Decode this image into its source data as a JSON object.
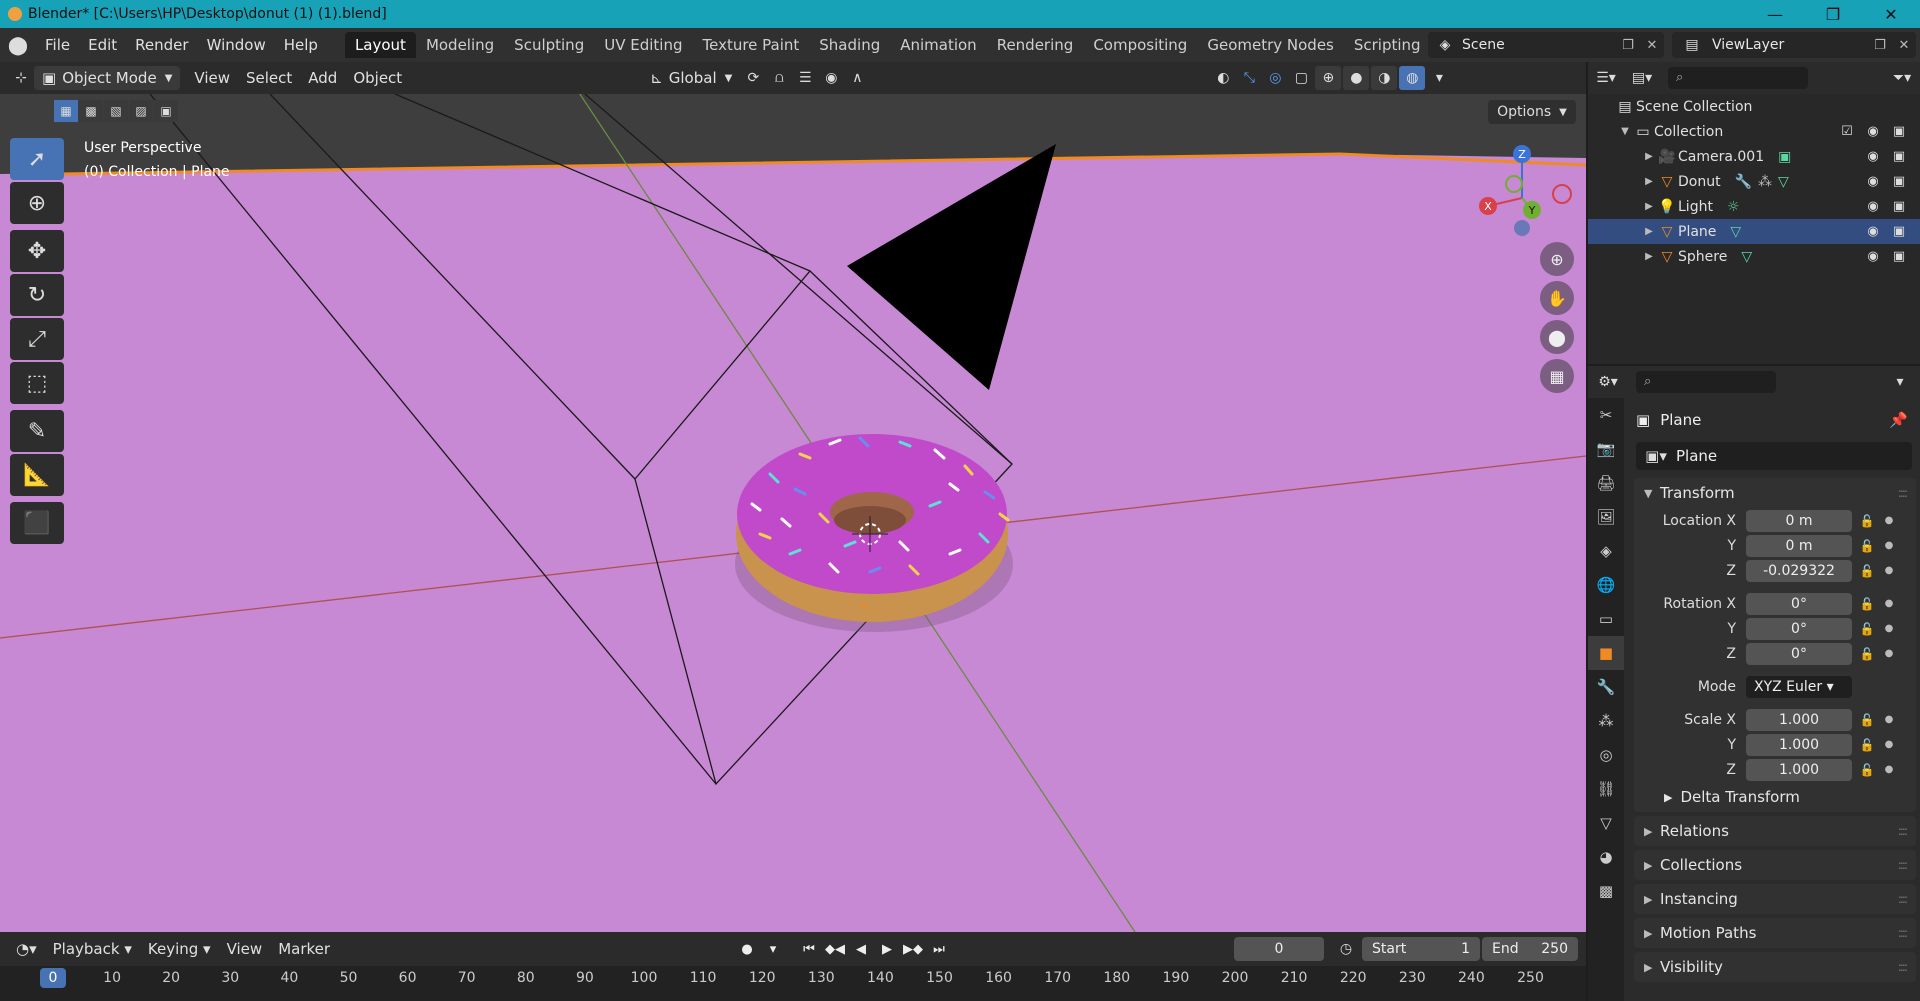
{
  "window": {
    "title": "Blender* [C:\\Users\\HP\\Desktop\\donut (1) (1).blend]",
    "controls": [
      "—",
      "❐",
      "✕"
    ]
  },
  "menu": [
    "File",
    "Edit",
    "Render",
    "Window",
    "Help"
  ],
  "workspaces": [
    "Layout",
    "Modeling",
    "Sculpting",
    "UV Editing",
    "Texture Paint",
    "Shading",
    "Animation",
    "Rendering",
    "Compositing",
    "Geometry Nodes",
    "Scripting"
  ],
  "active_workspace": "Layout",
  "scene": {
    "name": "Scene",
    "view_layer": "ViewLayer"
  },
  "viewport_header": {
    "mode": "Object Mode",
    "menus": [
      "View",
      "Select",
      "Add",
      "Object"
    ],
    "orientation": "Global"
  },
  "viewport": {
    "options_label": "Options",
    "info_line1": "User Perspective",
    "info_line2": "(0) Collection | Plane",
    "gizmo_axes": {
      "x": "X",
      "y": "Y",
      "z": "Z"
    },
    "background_color": "#c788d4"
  },
  "tools": [
    "select-box",
    "cursor",
    "move",
    "rotate",
    "scale",
    "transform",
    "annotate",
    "measure",
    "add-cube"
  ],
  "timeline": {
    "menus": [
      "Playback",
      "Keying",
      "View",
      "Marker"
    ],
    "current_frame": "0",
    "start_label": "Start",
    "start_value": "1",
    "end_label": "End",
    "end_value": "250",
    "ticks": [
      "0",
      "10",
      "20",
      "30",
      "40",
      "50",
      "60",
      "70",
      "80",
      "90",
      "100",
      "110",
      "120",
      "130",
      "140",
      "150",
      "160",
      "170",
      "180",
      "190",
      "200",
      "210",
      "220",
      "230",
      "240",
      "250"
    ]
  },
  "outliner": {
    "root": "Scene Collection",
    "collection": "Collection",
    "items": [
      {
        "name": "Camera.001",
        "icon": "camera-icon"
      },
      {
        "name": "Donut",
        "icon": "mesh-icon"
      },
      {
        "name": "Light",
        "icon": "light-icon"
      },
      {
        "name": "Plane",
        "icon": "mesh-icon",
        "selected": true
      },
      {
        "name": "Sphere",
        "icon": "mesh-icon"
      }
    ]
  },
  "properties": {
    "object_name": "Plane",
    "data_name": "Plane",
    "transform_label": "Transform",
    "location_label": "Location X",
    "location": {
      "x": "0 m",
      "y": "0 m",
      "z": "-0.029322"
    },
    "rotation_label": "Rotation X",
    "rotation": {
      "x": "0°",
      "y": "0°",
      "z": "0°"
    },
    "mode_label": "Mode",
    "mode_value": "XYZ Euler",
    "scale_label": "Scale X",
    "scale": {
      "x": "1.000",
      "y": "1.000",
      "z": "1.000"
    },
    "y_label": "Y",
    "z_label": "Z",
    "delta_transform": "Delta Transform",
    "panels": [
      "Relations",
      "Collections",
      "Instancing",
      "Motion Paths",
      "Visibility"
    ]
  }
}
